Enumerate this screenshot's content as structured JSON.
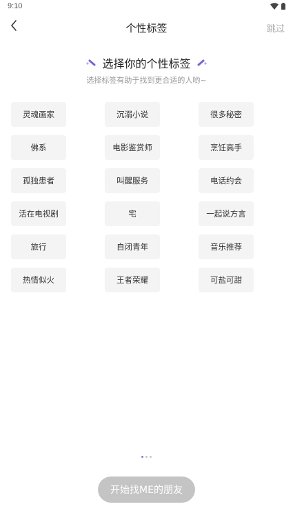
{
  "status_bar": {
    "time": "9:10"
  },
  "nav": {
    "title": "个性标签",
    "skip_label": "跳过"
  },
  "heading": {
    "title": "选择你的个性标签",
    "subtitle": "选择标签有助于找到更合适的人哟~"
  },
  "tags": [
    "灵魂画家",
    "沉溺小说",
    "很多秘密",
    "佛系",
    "电影鉴赏师",
    "烹饪高手",
    "孤独患者",
    "叫醒服务",
    "电话约会",
    "活在电视剧",
    "宅",
    "一起说方言",
    "旅行",
    "自闭青年",
    "音乐推荐",
    "热情似火",
    "王者荣耀",
    "可盐可甜"
  ],
  "pager": {
    "active_index": 0,
    "count": 3
  },
  "footer": {
    "start_label": "开始找ME的朋友"
  },
  "colors": {
    "accent": "#8a7bd8",
    "tag_bg": "#f4f4f4",
    "button_disabled": "#c4c4c4"
  },
  "icons": {
    "back": "chevron-left-icon",
    "sparkle": "sparkle-icon",
    "wifi": "wifi-icon",
    "battery": "battery-icon"
  }
}
